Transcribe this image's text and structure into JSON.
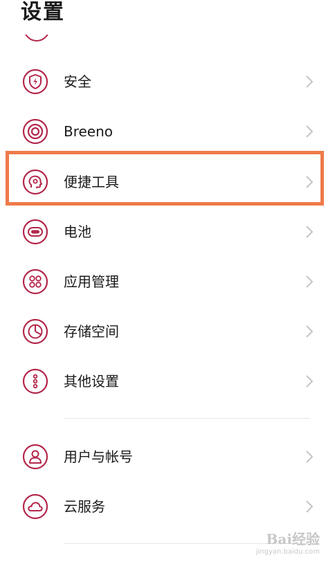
{
  "header": {
    "title": "设置"
  },
  "items": [
    {
      "label": "安全",
      "icon": "shield-icon"
    },
    {
      "label": "Breeno",
      "icon": "breeno-icon"
    },
    {
      "label": "便捷工具",
      "icon": "convenience-tools-icon"
    },
    {
      "label": "电池",
      "icon": "battery-icon"
    },
    {
      "label": "应用管理",
      "icon": "app-management-icon"
    },
    {
      "label": "存储空间",
      "icon": "storage-icon"
    },
    {
      "label": "其他设置",
      "icon": "more-settings-icon"
    },
    {
      "label": "用户与帐号",
      "icon": "user-account-icon"
    },
    {
      "label": "云服务",
      "icon": "cloud-icon"
    }
  ],
  "watermark": {
    "main": "Bai经验",
    "sub": "jingyan.baidu.com"
  },
  "colors": {
    "accent": "#b3264a",
    "highlight": "#ee7a4a",
    "chevron": "#c4c4c4"
  }
}
